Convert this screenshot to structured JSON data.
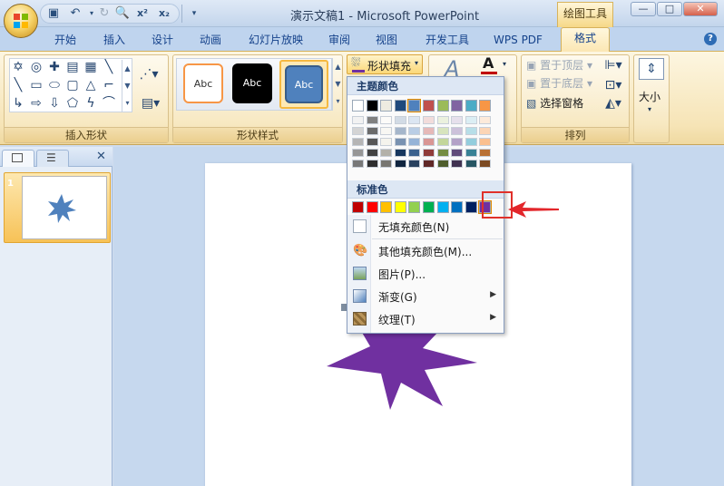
{
  "window": {
    "title": "演示文稿1 - Microsoft PowerPoint",
    "context_tab": "绘图工具",
    "min_label": "—",
    "max_label": "□",
    "close_label": "✕"
  },
  "qat": {
    "superscript_label": "x²",
    "subscript_label": "x₂"
  },
  "tabs": [
    "开始",
    "插入",
    "设计",
    "动画",
    "幻灯片放映",
    "审阅",
    "视图",
    "开发工具",
    "WPS PDF",
    "格式"
  ],
  "ribbon": {
    "insert_shapes_label": "插入形状",
    "shape_styles_label": "形状样式",
    "arrange_label": "排列",
    "size_label": "大小",
    "style_sample_text": "Abc",
    "shape_fill_label": "形状填充",
    "bring_forward": "置于顶层",
    "send_backward": "置于底层",
    "selection_pane": "选择窗格"
  },
  "slides_panel": {
    "slide_number": "1"
  },
  "fill_menu": {
    "theme_colors_label": "主题颜色",
    "standard_colors_label": "标准色",
    "no_fill": "无填充颜色(N)",
    "more_colors": "其他填充颜色(M)...",
    "picture": "图片(P)...",
    "gradient": "渐变(G)",
    "texture": "纹理(T)",
    "theme_top_row": [
      "#ffffff",
      "#000000",
      "#eeece1",
      "#1f497d",
      "#4f81bd",
      "#c0504d",
      "#9bbb59",
      "#8064a2",
      "#4bacc6",
      "#f79646"
    ],
    "standard_colors": [
      "#c00000",
      "#ff0000",
      "#ffc000",
      "#ffff00",
      "#92d050",
      "#00b050",
      "#00b0f0",
      "#0070c0",
      "#002060",
      "#7030a0"
    ],
    "selected_standard_color": "#7030a0"
  },
  "slide_shape": {
    "fill_color": "#7030a0",
    "thumb_fill_color": "#4f81bd"
  }
}
